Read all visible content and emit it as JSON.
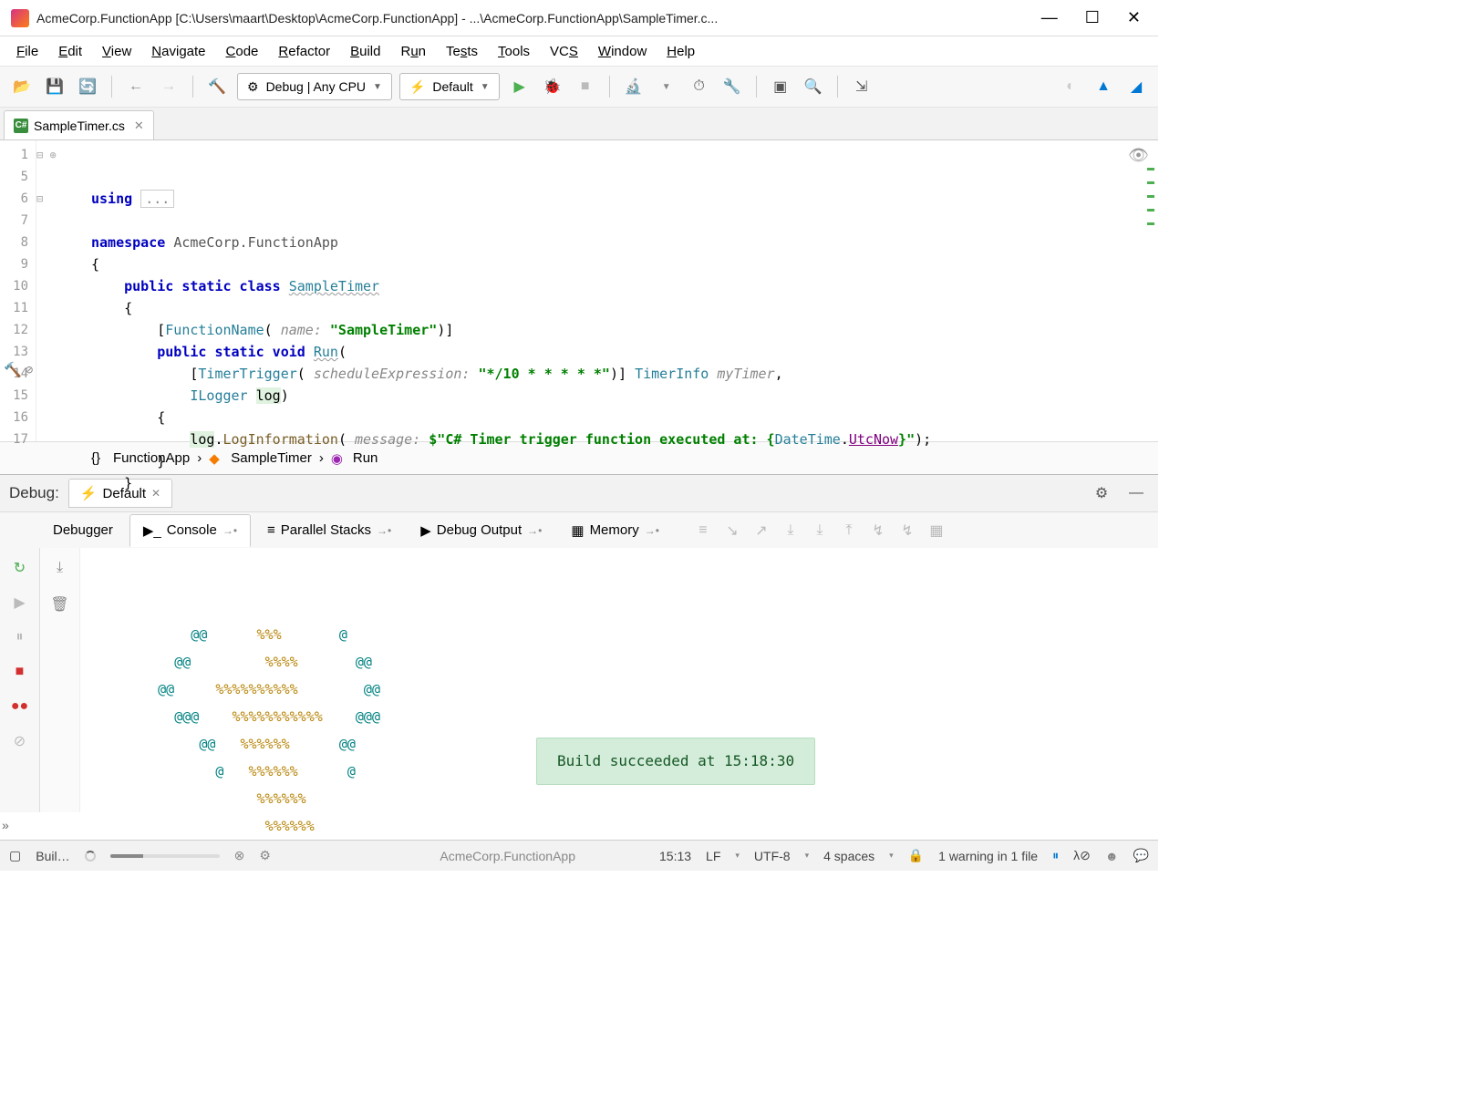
{
  "window": {
    "title": "AcmeCorp.FunctionApp [C:\\Users\\maart\\Desktop\\AcmeCorp.FunctionApp] - ...\\AcmeCorp.FunctionApp\\SampleTimer.c..."
  },
  "menu": {
    "file": "File",
    "edit": "Edit",
    "view": "View",
    "navigate": "Navigate",
    "code": "Code",
    "refactor": "Refactor",
    "build": "Build",
    "run": "Run",
    "tests": "Tests",
    "tools": "Tools",
    "vcs": "VCS",
    "window": "Window",
    "help": "Help"
  },
  "toolbar": {
    "config": "Debug | Any CPU",
    "run_config": "Default"
  },
  "tab": {
    "filename": "SampleTimer.cs",
    "lang": "C#"
  },
  "gutter_lines": [
    "1",
    "5",
    "6",
    "7",
    "8",
    "9",
    "10",
    "11",
    "12",
    "13",
    "14",
    "15",
    "16",
    "17"
  ],
  "code": {
    "l1a": "using",
    "l1b": "...",
    "l6a": "namespace",
    "l6b": "AcmeCorp.FunctionApp",
    "l7": "{",
    "l8a": "public static class",
    "l8b": "SampleTimer",
    "l9": "{",
    "l10a": "[",
    "l10b": "FunctionName",
    "l10c": "(",
    "l10h": "name:",
    "l10d": "\"SampleTimer\"",
    "l10e": ")]",
    "l11a": "public static void",
    "l11b": "Run",
    "l11c": "(",
    "l12a": "[",
    "l12b": "TimerTrigger",
    "l12c": "(",
    "l12h": "scheduleExpression:",
    "l12d": "\"*/10 * * * * *\"",
    "l12e": ")] ",
    "l12f": "TimerInfo",
    "l12g": "myTimer",
    "l12i": ",",
    "l13a": "ILogger",
    "l13b": "log",
    "l13c": ")",
    "l14": "{",
    "l15a": "log",
    "l15b": ".",
    "l15c": "LogInformation",
    "l15d": "(",
    "l15h": "message:",
    "l15e": "$\"C# Timer trigger function executed at: {",
    "l15f": "DateTime",
    "l15g": ".",
    "l15p": "UtcNow",
    "l15i": "}\"",
    "l15j": ");",
    "l16": "}",
    "l17": "}"
  },
  "breadcrumb": {
    "ns": "FunctionApp",
    "cls": "SampleTimer",
    "method": "Run"
  },
  "debug": {
    "label": "Debug:",
    "tab": "Default",
    "subtabs": {
      "debugger": "Debugger",
      "console": "Console",
      "parallel": "Parallel Stacks",
      "output": "Debug Output",
      "memory": "Memory"
    }
  },
  "console_art": [
    {
      "pad": "                  ",
      "y": "%%%%%%",
      "g1": "",
      "g2": ""
    },
    {
      "pad": "                 ",
      "y": "%%%%%%",
      "g1": "",
      "g2": ""
    },
    {
      "pad": "            ",
      "g1": "@   ",
      "y": "%%%%%%",
      "g2": "      @"
    },
    {
      "pad": "          ",
      "g1": "@@   ",
      "y": "%%%%%%",
      "g2": "      @@"
    },
    {
      "pad": "       ",
      "g1": "@@@    ",
      "y": "%%%%%%%%%%%",
      "g2": "    @@@"
    },
    {
      "pad": "     ",
      "g1": "@@     ",
      "y": "%%%%%%%%%%",
      "g2": "        @@"
    },
    {
      "pad": "       ",
      "g1": "@@         ",
      "y": "%%%%",
      "g2": "       @@"
    },
    {
      "pad": "         ",
      "g1": "@@      ",
      "y": "%%%",
      "g2": "       @"
    }
  ],
  "toast": "Build succeeded at 15:18:30",
  "status": {
    "build": "Buil…",
    "project": "AcmeCorp.FunctionApp",
    "pos": "15:13",
    "eol": "LF",
    "enc": "UTF-8",
    "indent": "4 spaces",
    "warn": "1 warning in 1 file"
  }
}
